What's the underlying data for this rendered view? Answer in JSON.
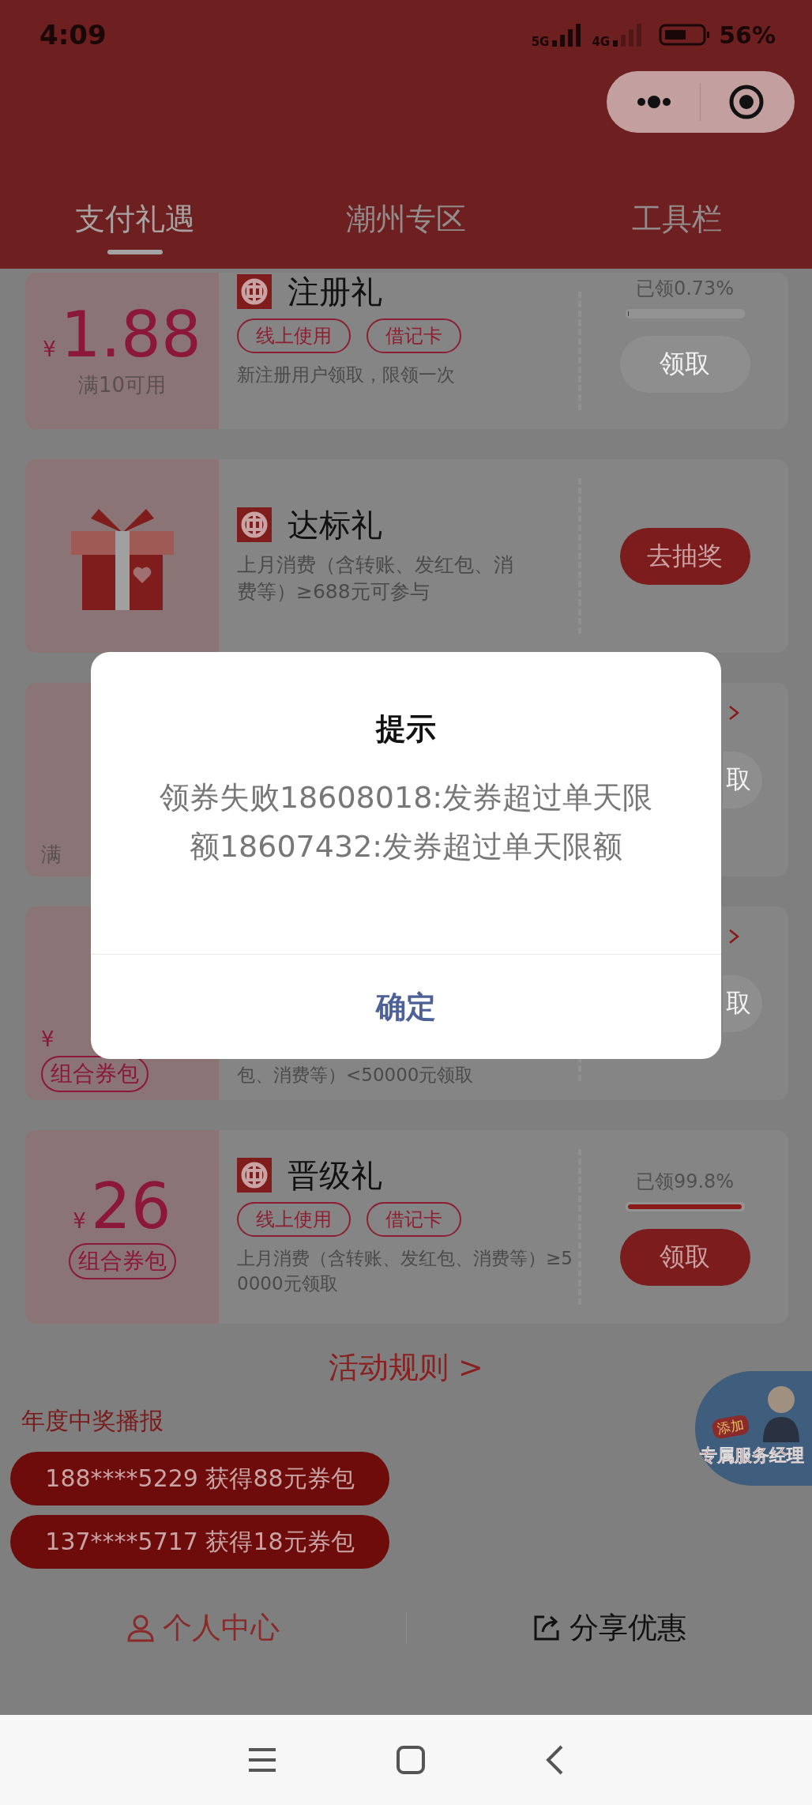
{
  "status_bar": {
    "time": "4:09",
    "network_1": "5G",
    "network_2": "4G",
    "battery": "56%"
  },
  "tabs": [
    {
      "label": "支付礼遇",
      "selected": true
    },
    {
      "label": "潮州专区",
      "selected": false
    },
    {
      "label": "工具栏",
      "selected": false
    }
  ],
  "coupons": [
    {
      "kind": "amount",
      "currency": "¥",
      "amount": "1.88",
      "condition": "满10可用",
      "title": "注册礼",
      "tags": [
        "线上使用",
        "借记卡"
      ],
      "description": "新注册用户领取，限领一次",
      "claimed": "已领0.73%",
      "level": 0.0073,
      "button": {
        "label": "领取",
        "disabled": true
      }
    },
    {
      "kind": "gift",
      "title": "达标礼",
      "description": "上月消费（含转账、发红包、消费等）≥688元可参与",
      "button": {
        "label": "去抽奖",
        "disabled": false
      }
    },
    {
      "kind": "partial",
      "condition": "满",
      "button": {
        "label": "取",
        "disabled": true
      }
    },
    {
      "kind": "partial",
      "currency": "¥",
      "package": "组合券包",
      "description": "包、消费等）<50000元领取",
      "button": {
        "label": "取",
        "disabled": true
      }
    },
    {
      "kind": "amount",
      "currency": "¥",
      "amount": "26",
      "package": "组合券包",
      "title": "晋级礼",
      "tags": [
        "线上使用",
        "借记卡"
      ],
      "description": "上月消费（含转账、发红包、消费等）≥50000元领取",
      "claimed": "已领99.8%",
      "level": 0.998,
      "button": {
        "label": "领取",
        "disabled": false
      }
    }
  ],
  "rules_link": "活动规则 >",
  "prize_feed": {
    "title": "年度中奖播报",
    "items": [
      "188****5229 获得88元券包",
      "137****5717 获得18元券包"
    ]
  },
  "service_badge": {
    "tag": "添加",
    "label": "专属服务经理"
  },
  "bottom_nav": [
    {
      "label": "个人中心",
      "kind": "person"
    },
    {
      "label": "分享优惠",
      "kind": "share"
    }
  ],
  "dialog": {
    "title": "提示",
    "message": "领券失败18608018:发券超过单天限额18607432:发券超过单天限额",
    "button": "确定"
  }
}
